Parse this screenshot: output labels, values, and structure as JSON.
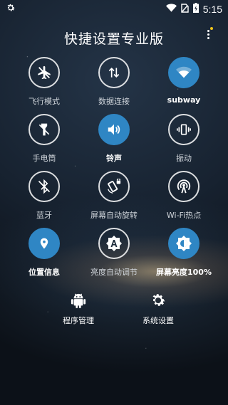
{
  "status_bar": {
    "time": "5:15",
    "icons": [
      "settings-gear-icon",
      "wifi-icon",
      "no-sim-icon",
      "battery-charging-icon"
    ]
  },
  "header": {
    "title": "快捷设置专业版",
    "menu_icon": "more-vertical-icon",
    "notification_dot_color": "#f0c419"
  },
  "colors": {
    "active": "#2f86c4",
    "inactive_border": "#ffffff",
    "label_inactive": "#cfd4da"
  },
  "tiles": [
    {
      "label": "飞行模式",
      "icon": "airplane-off-icon",
      "active": false
    },
    {
      "label": "数据连接",
      "icon": "data-arrows-icon",
      "active": false
    },
    {
      "label": "subway",
      "icon": "wifi-icon",
      "active": true
    },
    {
      "label": "手电筒",
      "icon": "flashlight-off-icon",
      "active": false
    },
    {
      "label": "铃声",
      "icon": "volume-icon",
      "active": true
    },
    {
      "label": "振动",
      "icon": "vibrate-icon",
      "active": false
    },
    {
      "label": "蓝牙",
      "icon": "bluetooth-off-icon",
      "active": false
    },
    {
      "label": "屏幕自动旋转",
      "icon": "screen-rotation-lock-icon",
      "active": false
    },
    {
      "label": "Wi-Fi热点",
      "icon": "hotspot-icon",
      "active": false
    },
    {
      "label": "位置信息",
      "icon": "location-pin-icon",
      "active": true
    },
    {
      "label": "亮度自动调节",
      "icon": "auto-brightness-icon",
      "active": false
    },
    {
      "label": "屏幕亮度100%",
      "icon": "brightness-icon",
      "active": true
    }
  ],
  "bottom": [
    {
      "label": "程序管理",
      "icon": "android-icon"
    },
    {
      "label": "系统设置",
      "icon": "settings-gear-icon"
    }
  ]
}
